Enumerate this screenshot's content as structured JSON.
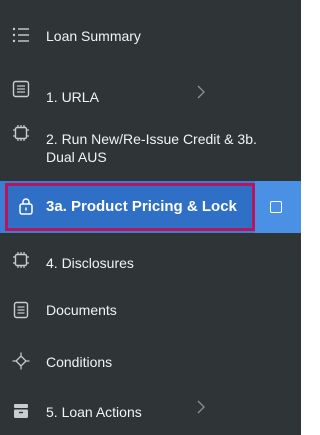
{
  "sidebar": {
    "items": [
      {
        "id": "loan-summary",
        "label": "Loan Summary",
        "icon": "list-icon",
        "has_chevron": false,
        "active": false
      },
      {
        "id": "urla",
        "label": "1. URLA",
        "icon": "form-icon",
        "has_chevron": true,
        "active": false
      },
      {
        "id": "run-credit",
        "label": "2. Run New/Re-Issue Credit & 3b. Dual AUS",
        "icon": "chip-icon",
        "has_chevron": false,
        "active": false
      },
      {
        "id": "product-pricing",
        "label": "3a. Product Pricing & Lock",
        "icon": "lock-icon",
        "has_chevron": false,
        "active": true
      },
      {
        "id": "disclosures",
        "label": "4. Disclosures",
        "icon": "chip-icon",
        "has_chevron": false,
        "active": false
      },
      {
        "id": "documents",
        "label": "Documents",
        "icon": "document-icon",
        "has_chevron": false,
        "active": false
      },
      {
        "id": "conditions",
        "label": "Conditions",
        "icon": "conditions-icon",
        "has_chevron": false,
        "active": false
      },
      {
        "id": "loan-actions",
        "label": "5. Loan Actions",
        "icon": "drawer-icon",
        "has_chevron": true,
        "active": false
      }
    ]
  },
  "colors": {
    "sidebar_bg": "#2f3437",
    "active_bg": "#3a7fd6",
    "highlight_border": "#b5165e",
    "text": "#f1f3f4"
  }
}
